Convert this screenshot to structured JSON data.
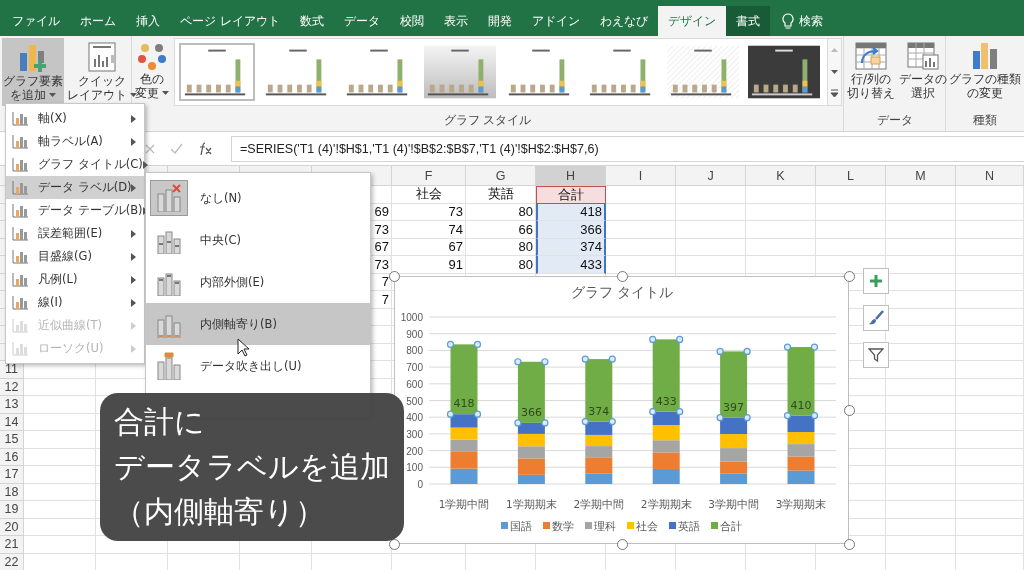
{
  "tabs": [
    {
      "label": "ファイル",
      "selected": false,
      "kind": "normal"
    },
    {
      "label": "ホーム",
      "selected": false,
      "kind": "normal"
    },
    {
      "label": "挿入",
      "selected": false,
      "kind": "normal"
    },
    {
      "label": "ページ レイアウト",
      "selected": false,
      "kind": "normal"
    },
    {
      "label": "数式",
      "selected": false,
      "kind": "normal"
    },
    {
      "label": "データ",
      "selected": false,
      "kind": "normal"
    },
    {
      "label": "校閲",
      "selected": false,
      "kind": "normal"
    },
    {
      "label": "表示",
      "selected": false,
      "kind": "normal"
    },
    {
      "label": "開発",
      "selected": false,
      "kind": "normal"
    },
    {
      "label": "アドイン",
      "selected": false,
      "kind": "normal"
    },
    {
      "label": "わえなび",
      "selected": false,
      "kind": "normal"
    },
    {
      "label": "デザイン",
      "selected": true,
      "kind": "contextual"
    },
    {
      "label": "書式",
      "selected": false,
      "kind": "contextual"
    }
  ],
  "tell_me": {
    "label": "検索"
  },
  "ribbon": {
    "groups": [
      {
        "buttons": [
          {
            "kind": "chart-elements",
            "lines": [
              "グラフ要素",
              "を追加"
            ],
            "dropdown": true,
            "selected": true
          },
          {
            "kind": "quick-layout",
            "lines": [
              "クイック",
              "レイアウト"
            ],
            "dropdown": true,
            "selected": false
          }
        ]
      },
      {
        "label": "グラフ スタイル",
        "buttons": [
          {
            "kind": "colors",
            "lines": [
              "色の",
              "変更"
            ],
            "dropdown": true,
            "selected": false
          }
        ],
        "gallery": [
          {
            "kind": "plain",
            "selected": true
          },
          {
            "kind": "plain",
            "selected": false
          },
          {
            "kind": "plain",
            "selected": false
          },
          {
            "kind": "shaded",
            "selected": false
          },
          {
            "kind": "plain",
            "selected": false
          },
          {
            "kind": "plain",
            "selected": false
          },
          {
            "kind": "hatched",
            "selected": false
          },
          {
            "kind": "dark",
            "selected": false
          }
        ]
      },
      {
        "label": "データ",
        "buttons": [
          {
            "kind": "switch",
            "lines": [
              "行/列の",
              "切り替え"
            ],
            "dropdown": false,
            "selected": false
          },
          {
            "kind": "select-data",
            "lines": [
              "データの",
              "選択"
            ],
            "dropdown": false,
            "selected": false
          }
        ]
      },
      {
        "label": "種類",
        "buttons": [
          {
            "kind": "chart-type",
            "lines": [
              "グラフの種類",
              "の変更"
            ],
            "dropdown": false,
            "selected": false
          }
        ]
      }
    ]
  },
  "formula_bar": {
    "formula": "=SERIES('T1 (4)'!$H$1,'T1 (4)'!$B$2:$B$7,'T1 (4)'!$H$2:$H$7,6)"
  },
  "sheet": {
    "column_headers": [
      "F",
      "G",
      "H",
      "I",
      "J",
      "K",
      "L",
      "M",
      "N"
    ],
    "row_numbers": [
      "11",
      "12",
      "13",
      "14",
      "15",
      "16",
      "17",
      "18",
      "19",
      "20",
      "21",
      "22"
    ],
    "rows": [
      {
        "cells": {
          "F": {
            "text": "社会"
          },
          "G": {
            "text": "英語"
          },
          "H": {
            "text": "合計",
            "name_ref": true
          }
        }
      },
      {
        "cells": {
          "E": {
            "text": "69"
          },
          "F": {
            "text": "73"
          },
          "G": {
            "text": "80"
          },
          "H": {
            "text": "418",
            "value_ref": true
          }
        }
      },
      {
        "cells": {
          "E": {
            "text": "73"
          },
          "F": {
            "text": "74"
          },
          "G": {
            "text": "66"
          },
          "H": {
            "text": "366",
            "value_ref": true
          }
        }
      },
      {
        "cells": {
          "E": {
            "text": "67"
          },
          "F": {
            "text": "67"
          },
          "G": {
            "text": "80"
          },
          "H": {
            "text": "374",
            "value_ref": true
          }
        }
      },
      {
        "cells": {
          "E": {
            "text": "73"
          },
          "F": {
            "text": "91"
          },
          "G": {
            "text": "80"
          },
          "H": {
            "text": "433",
            "value_ref": true
          }
        }
      },
      {
        "cells": {
          "E": {
            "text": "7"
          }
        }
      },
      {
        "cells": {
          "E": {
            "text": "7"
          }
        }
      }
    ]
  },
  "menu": {
    "items": [
      {
        "label": "軸(X)",
        "disabled": false,
        "selected": false
      },
      {
        "label": "軸ラベル(A)",
        "disabled": false,
        "selected": false
      },
      {
        "label": "グラフ タイトル(C)",
        "disabled": false,
        "selected": false
      },
      {
        "label": "データ ラベル(D)",
        "disabled": false,
        "selected": true
      },
      {
        "label": "データ テーブル(B)",
        "disabled": false,
        "selected": false
      },
      {
        "label": "誤差範囲(E)",
        "disabled": false,
        "selected": false
      },
      {
        "label": "目盛線(G)",
        "disabled": false,
        "selected": false
      },
      {
        "label": "凡例(L)",
        "disabled": false,
        "selected": false
      },
      {
        "label": "線(I)",
        "disabled": false,
        "selected": false
      },
      {
        "label": "近似曲線(T)",
        "disabled": true,
        "selected": false
      },
      {
        "label": "ローソク(U)",
        "disabled": true,
        "selected": false
      }
    ]
  },
  "submenu": {
    "items": [
      {
        "kind": "none",
        "label": "なし(N)",
        "current": true,
        "selected": false
      },
      {
        "kind": "center",
        "label": "中央(C)",
        "current": false,
        "selected": false
      },
      {
        "kind": "inside-end",
        "label": "内部外側(E)",
        "current": false,
        "selected": false
      },
      {
        "kind": "inside-base",
        "label": "内側軸寄り(B)",
        "current": false,
        "selected": true
      },
      {
        "kind": "callout",
        "label": "データ吹き出し(U)",
        "current": false,
        "selected": false
      }
    ]
  },
  "chart": {
    "selected_series": [
      false,
      false,
      false,
      false,
      false,
      true
    ],
    "chart_data": {
      "type": "bar",
      "stacked": true,
      "title": "グラフ タイトル",
      "grid": true,
      "legend": true,
      "categories": [
        "1学期中間",
        "1学期期末",
        "2学期中間",
        "2学期期末",
        "3学期中間",
        "3学期期末"
      ],
      "ylim": [
        0,
        1000
      ],
      "yticks": [
        0,
        100,
        200,
        300,
        400,
        500,
        600,
        700,
        800,
        900,
        1000
      ],
      "series": [
        {
          "name": "国語",
          "color": "#5b9bd5",
          "values": [
            92,
            55,
            64,
            90,
            64,
            80
          ]
        },
        {
          "name": "数学",
          "color": "#ed7d31",
          "values": [
            104,
            98,
            96,
            99,
            71,
            85
          ]
        },
        {
          "name": "理科",
          "color": "#a5a5a5",
          "values": [
            69,
            73,
            67,
            73,
            80,
            74
          ]
        },
        {
          "name": "社会",
          "color": "#ffc000",
          "values": [
            73,
            74,
            67,
            91,
            84,
            72
          ]
        },
        {
          "name": "英語",
          "color": "#4472c4",
          "values": [
            80,
            66,
            80,
            80,
            98,
            99
          ]
        },
        {
          "name": "合計",
          "color": "#70ad47",
          "values": [
            418,
            366,
            374,
            433,
            397,
            410
          ],
          "value_labels": [
            "418",
            "366",
            "374",
            "433",
            "397",
            "410"
          ]
        }
      ]
    }
  },
  "caption": {
    "lines": [
      "合計に",
      "データラベルを追加",
      "（内側軸寄り）"
    ]
  }
}
